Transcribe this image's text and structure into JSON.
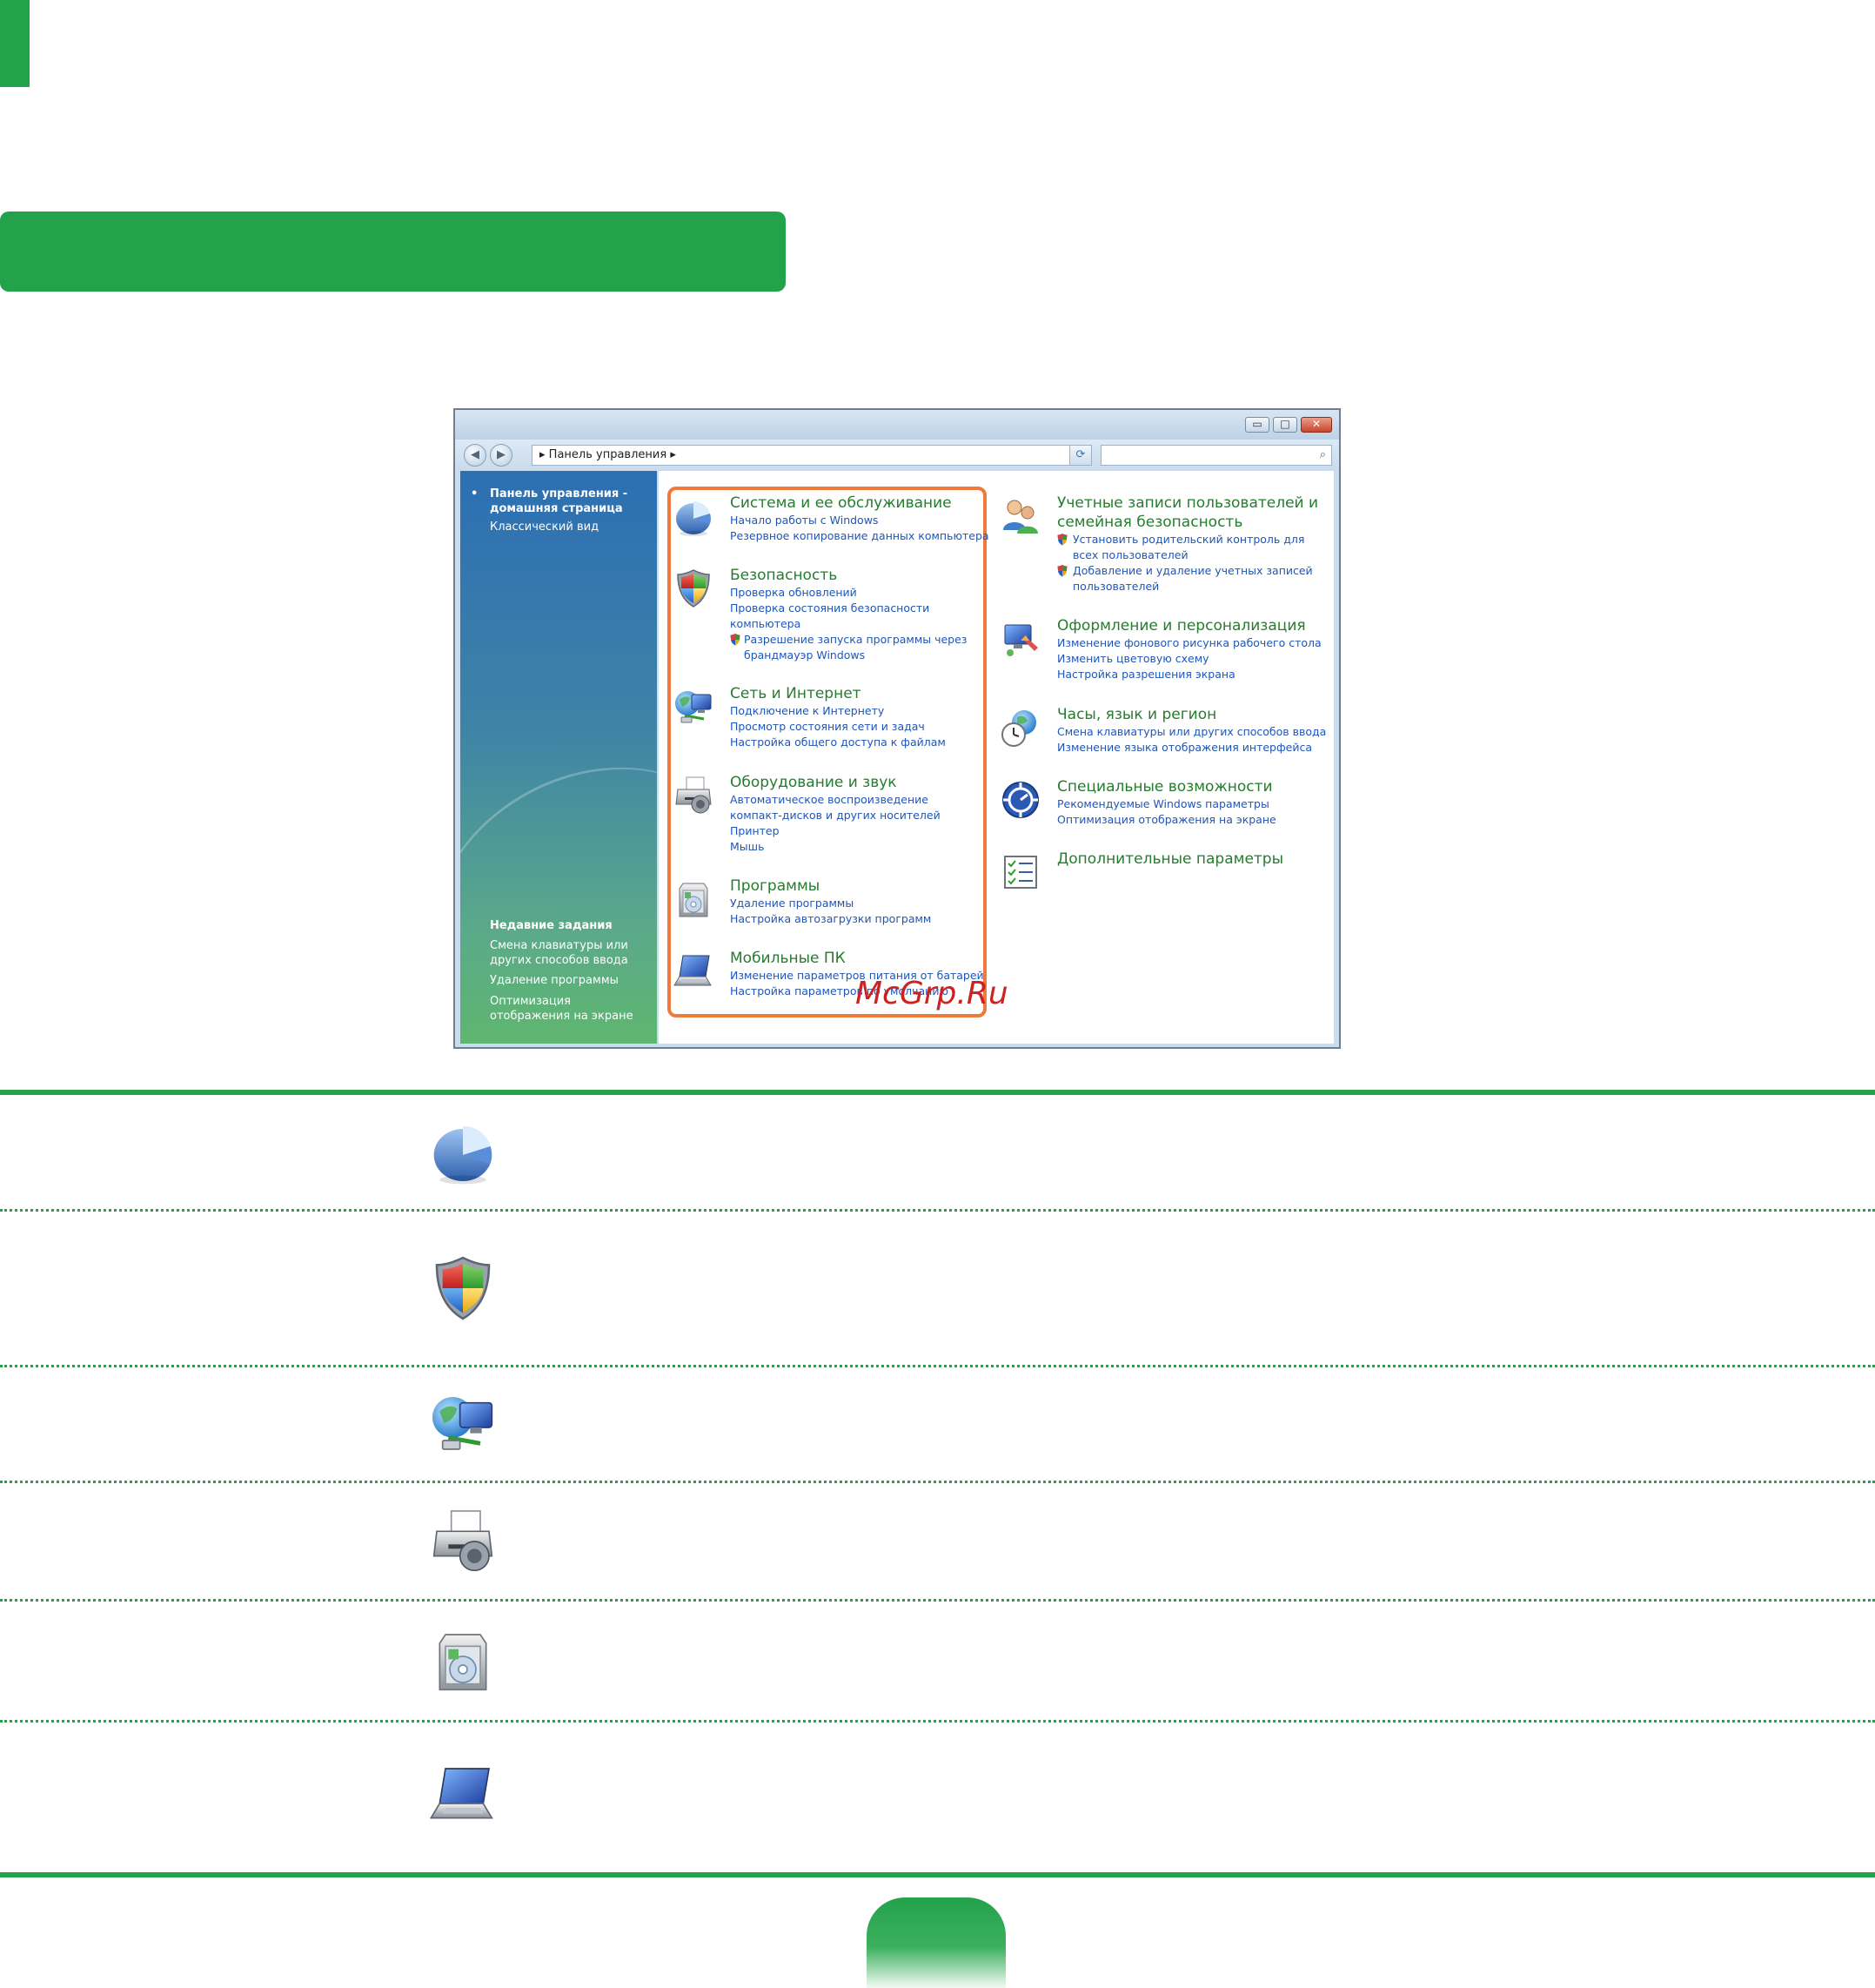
{
  "window": {
    "buttons": {
      "minimize": "▭",
      "maximize": "□",
      "close": "✕"
    },
    "nav": {
      "back": "◀",
      "forward": "▶"
    },
    "address": {
      "path": "Панель управления",
      "separator": "▸"
    },
    "search": {
      "icon_glyph": "⌕"
    }
  },
  "sidebar": {
    "home_label": "Панель управления - домашняя страница",
    "classic_label": "Классический вид",
    "recent_title": "Недавние задания",
    "recent": [
      {
        "label": "Смена клавиатуры или других способов ввода"
      },
      {
        "label": "Удаление программы"
      },
      {
        "label": "Оптимизация отображения на экране"
      }
    ]
  },
  "left_categories": [
    {
      "icon": "system-pie-icon",
      "title": "Система и ее обслуживание",
      "links": [
        "Начало работы с Windows",
        "Резервное копирование данных компьютера"
      ]
    },
    {
      "icon": "security-shield-icon",
      "title": "Безопасность",
      "links": [
        "Проверка обновлений",
        "Проверка состояния безопасности компьютера",
        "Разрешение запуска программы через брандмауэр Windows"
      ]
    },
    {
      "icon": "network-globe-icon",
      "title": "Сеть и Интернет",
      "links": [
        "Подключение к Интернету",
        "Просмотр состояния сети и задач",
        "Настройка общего доступа к файлам"
      ]
    },
    {
      "icon": "hardware-printer-icon",
      "title": "Оборудование и звук",
      "links": [
        "Автоматическое воспроизведение компакт-дисков и других носителей",
        "Принтер",
        "Мышь"
      ]
    },
    {
      "icon": "programs-box-icon",
      "title": "Программы",
      "links": [
        "Удаление программы",
        "Настройка автозагрузки программ"
      ]
    },
    {
      "icon": "mobile-laptop-icon",
      "title": "Мобильные ПК",
      "links": [
        "Изменение параметров питания от батарей",
        "Настройка параметров по умолчанию"
      ]
    }
  ],
  "right_categories": [
    {
      "icon": "users-icon",
      "title": "Учетные записи пользователей и семейная безопасность",
      "links": [
        "Установить родительский контроль для всех пользователей",
        "Добавление и удаление учетных записей пользователей"
      ]
    },
    {
      "icon": "appearance-icon",
      "title": "Оформление и персонализация",
      "links": [
        "Изменение фонового рисунка рабочего стола",
        "Изменить цветовую схему",
        "Настройка разрешения экрана"
      ]
    },
    {
      "icon": "clock-globe-icon",
      "title": "Часы, язык и регион",
      "links": [
        "Смена клавиатуры или других способов ввода",
        "Изменение языка отображения интерфейса"
      ]
    },
    {
      "icon": "accessibility-icon",
      "title": "Специальные возможности",
      "links": [
        "Рекомендуемые Windows параметры",
        "Оптимизация отображения на экране"
      ]
    },
    {
      "icon": "checklist-icon",
      "title": "Дополнительные параметры",
      "links": []
    }
  ],
  "watermark": "McGrp.Ru",
  "table_rows": [
    {
      "icon": "system-pie-icon"
    },
    {
      "icon": "security-shield-icon"
    },
    {
      "icon": "network-globe-icon"
    },
    {
      "icon": "hardware-printer-icon"
    },
    {
      "icon": "programs-box-icon"
    },
    {
      "icon": "mobile-laptop-icon"
    }
  ],
  "colors": {
    "accent": "#22a24a",
    "highlight": "#f07a3c",
    "link": "#1f56b8",
    "category": "#267c2f"
  }
}
